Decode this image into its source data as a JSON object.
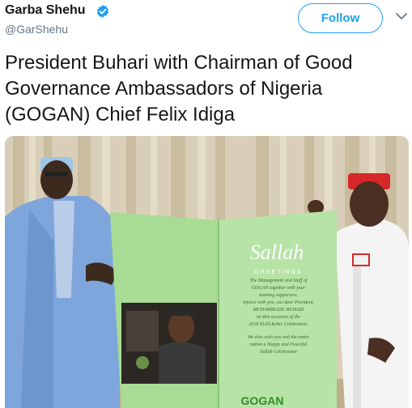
{
  "user": {
    "display_name": "Garba Shehu",
    "handle": "@GarShehu",
    "verified": true,
    "verified_icon": "verified-badge-icon"
  },
  "actions": {
    "follow_label": "Follow",
    "menu_icon": "chevron-down-icon"
  },
  "tweet": {
    "text": "President Buhari with Chairman of Good Governance Ambassadors of Nigeria (GOGAN) Chief Felix Idiga"
  },
  "card": {
    "title": "Sallah",
    "subtitle": "GREETINGS",
    "message_lines": [
      "The Management and Staff of",
      "GOGAN together with your",
      "teaming supporters,",
      "rejoice with you, our dear President,",
      "MUHAMMADU BUHARI",
      "on this occasion of the",
      "2018 Id-El-Kebir Celebration.",
      "",
      "We also wish you and the entire",
      "nation a Happy and Peaceful",
      "Sallah Celebration"
    ],
    "logo": "GOGAN"
  },
  "colors": {
    "accent": "#1da1f2",
    "text": "#14171a",
    "secondary": "#657786",
    "card_green": "#9ed68a",
    "robe_blue": "#7fa6dc"
  }
}
